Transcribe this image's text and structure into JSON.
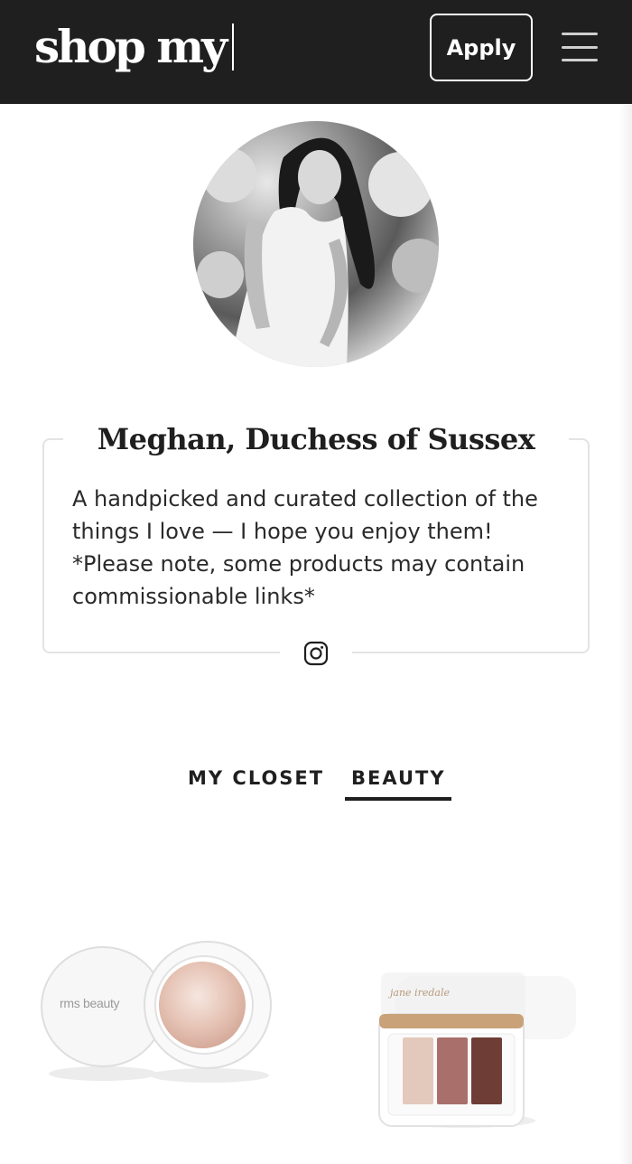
{
  "header": {
    "logo_text": "shop my",
    "apply_label": "Apply",
    "menu_icon": "hamburger-menu-icon"
  },
  "profile": {
    "name": "Meghan, Duchess of Sussex",
    "bio": "A handpicked and curated collection of the things I love — I hope you enjoy them! *Please note, some products may contain commissionable links*",
    "social_icon": "instagram-icon"
  },
  "tabs": [
    {
      "label": "MY CLOSET",
      "active": false
    },
    {
      "label": "BEAUTY",
      "active": true
    }
  ],
  "products": [
    {
      "brand_text": "rms beauty"
    },
    {
      "brand_text": "jane iredale"
    }
  ],
  "colors": {
    "header_bg": "#1f1f1f",
    "accent": "#1f1f1f",
    "border": "#e3e3e3"
  }
}
